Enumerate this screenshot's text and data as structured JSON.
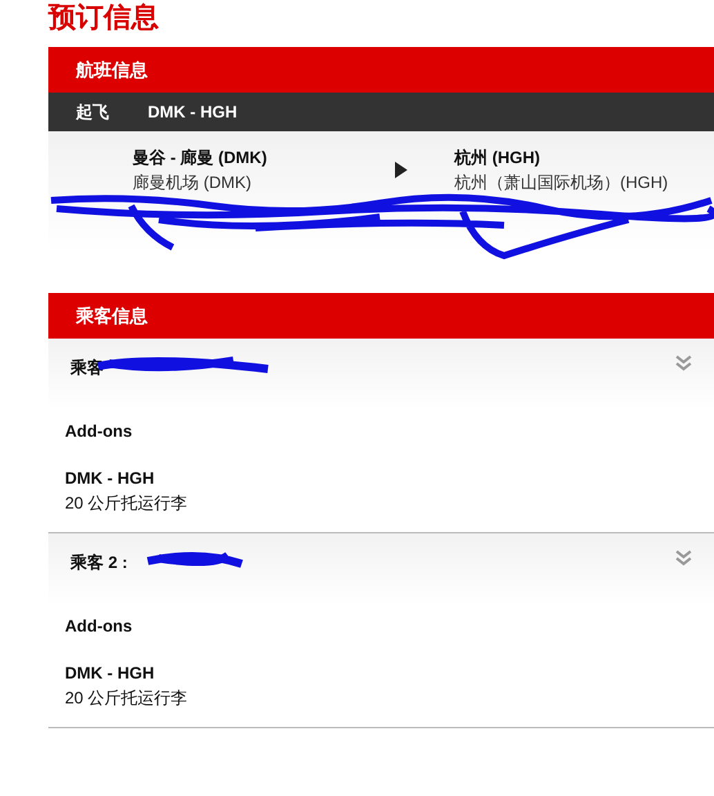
{
  "page_title": "预订信息",
  "flight_section": {
    "title": "航班信息",
    "segment": {
      "label": "起飞",
      "route": "DMK - HGH"
    },
    "departure": {
      "city": "曼谷 - 廊曼 (DMK)",
      "airport": "廊曼机场 (DMK)"
    },
    "arrival": {
      "city": "杭州 (HGH)",
      "airport": "杭州（萧山国际机场）(HGH)"
    }
  },
  "passenger_section": {
    "title": "乘客信息",
    "passengers": [
      {
        "name": "乘客",
        "addons_title": "Add-ons",
        "route": "DMK - HGH",
        "baggage": "20 公斤托运行李"
      },
      {
        "name": "乘客 2 :",
        "addons_title": "Add-ons",
        "route": "DMK - HGH",
        "baggage": "20 公斤托运行李"
      }
    ]
  }
}
